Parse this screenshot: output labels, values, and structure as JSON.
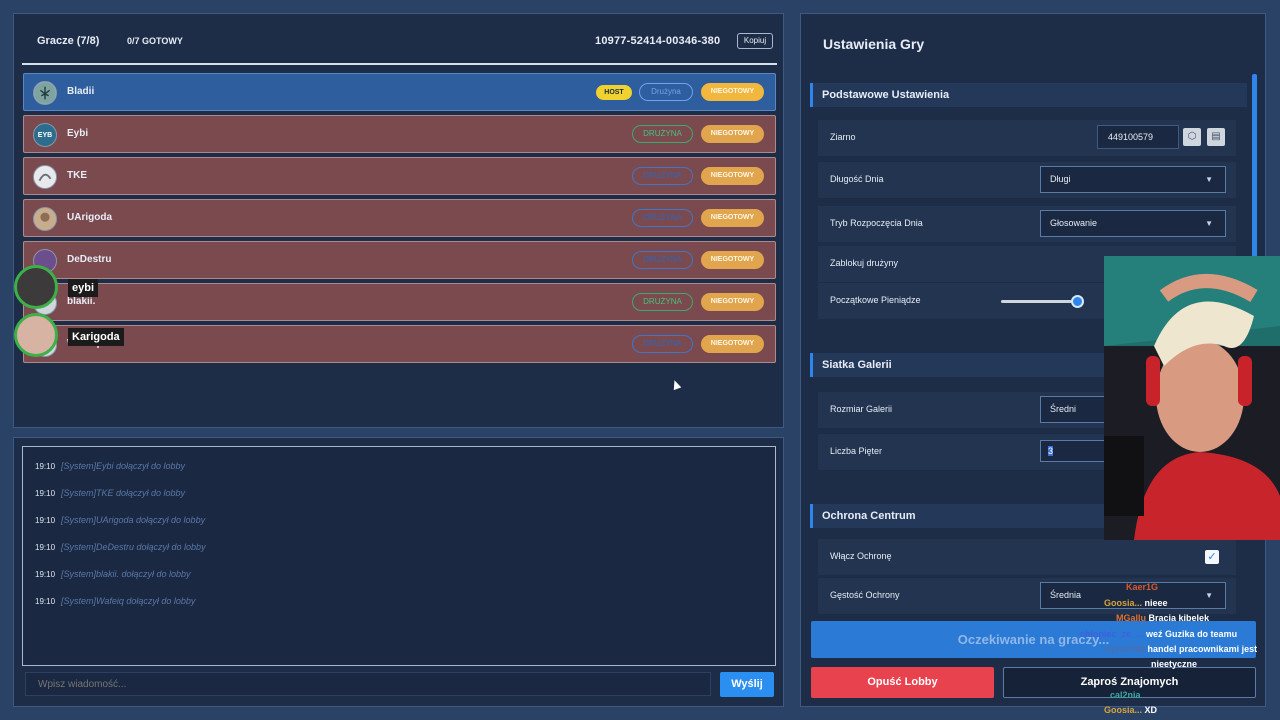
{
  "players_panel": {
    "title": "Gracze (7/8)",
    "ready_count": "0/7 GOTOWY",
    "lobby_code": "10977-52414-00346-380",
    "copy_label": "Kopiuj",
    "players": [
      {
        "name": "Bladii",
        "host_badge": "HOST",
        "team": "Drużyna",
        "status": "NIEGOTOWY",
        "is_host": true,
        "team_color": "blue"
      },
      {
        "name": "Eybi",
        "team": "DRUŻYNA",
        "status": "NIEGOTOWY",
        "team_color": "green"
      },
      {
        "name": "TKE",
        "team": "DRUŻYNA",
        "status": "NIEGOTOWY",
        "team_color": "blue"
      },
      {
        "name": "UArigoda",
        "team": "DRUŻYNA",
        "status": "NIEGOTOWY",
        "team_color": "blue"
      },
      {
        "name": "DeDestru",
        "team": "DRUŻYNA",
        "status": "NIEGOTOWY",
        "team_color": "blue"
      },
      {
        "name": "blakii.",
        "team": "DRUŻYNA",
        "status": "NIEGOTOWY",
        "team_color": "green"
      },
      {
        "name": "Wafeiq",
        "team": "DRUŻYNA",
        "status": "NIEGOTOWY",
        "team_color": "blue"
      }
    ],
    "voice_overlay": [
      {
        "name": "eybi"
      },
      {
        "name": "Karigoda"
      }
    ]
  },
  "chat": {
    "messages": [
      {
        "time": "19:10",
        "text": "[System]Eybi dołączył do lobby"
      },
      {
        "time": "19:10",
        "text": "[System]TKE dołączył do lobby"
      },
      {
        "time": "19:10",
        "text": "[System]UArigoda dołączył do lobby"
      },
      {
        "time": "19:10",
        "text": "[System]DeDestru dołączył do lobby"
      },
      {
        "time": "19:10",
        "text": "[System]blakii. dołączył do lobby"
      },
      {
        "time": "19:10",
        "text": "[System]Wafeiq dołączył do lobby"
      }
    ],
    "input_placeholder": "Wpisz wiadomość...",
    "send_label": "Wyślij"
  },
  "settings": {
    "title": "Ustawienia Gry",
    "basic_section": "Podstawowe Ustawienia",
    "seed_label": "Ziarno",
    "seed_value": "449100579",
    "day_length_label": "Długość Dnia",
    "day_length_value": "Długi",
    "day_start_label": "Tryb Rozpoczęcia Dnia",
    "day_start_value": "Głosowanie",
    "lock_teams_label": "Zablokuj drużyny",
    "starting_money_label": "Początkowe Pieniądze",
    "starting_money_fraction": 0.95,
    "gallery_section": "Siatka Galerii",
    "gallery_size_label": "Rozmiar Galerii",
    "gallery_size_value": "Średni",
    "floors_label": "Liczba Pięter",
    "floors_value": "3",
    "center_section": "Ochrona Centrum",
    "enable_protection_label": "Włącz Ochronę",
    "enable_protection_checked": true,
    "protection_density_label": "Gęstość Ochrony",
    "protection_density_value": "Średnia",
    "wait_label": "Oczekiwanie na graczy...",
    "leave_label": "Opuść Lobby",
    "invite_label": "Zaproś Znajomych"
  },
  "twitch_chat": [
    {
      "user": "Kaer1G",
      "text": ""
    },
    {
      "user": "Goosia...",
      "text": "nieee"
    },
    {
      "user": "MGallu",
      "text": "Bracia kibelek"
    },
    {
      "user": "chlopiec_ze_...",
      "text": "weź Guzika do teamu"
    },
    {
      "user": "vipma789",
      "text": "handel pracownikami jest"
    },
    {
      "user": "",
      "text": "nieetyczne"
    },
    {
      "user": "cal2nia",
      "text": ""
    },
    {
      "user": "Goosia...",
      "text": "XD"
    }
  ],
  "colors": {
    "background": "#2a4266",
    "panel": "#1d2d47",
    "accent": "#2e86ec",
    "not_ready": "#e1a64d",
    "host": "#f0d22e",
    "leave": "#e8424f"
  }
}
